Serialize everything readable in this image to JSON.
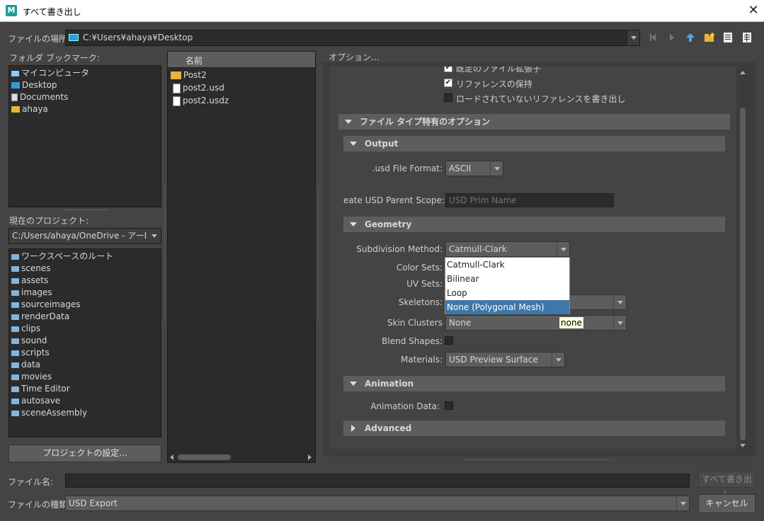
{
  "window": {
    "title": "すべて書き出し",
    "logo": "M",
    "close_icon": "✕"
  },
  "location": {
    "label": "ファイルの場所:",
    "path": "C:¥Users¥ahaya¥Desktop"
  },
  "bookmarks": {
    "label": "フォルダ ブックマーク:",
    "items": [
      "マイコンピュータ",
      "Desktop",
      "Documents",
      "ahaya"
    ]
  },
  "project": {
    "label": "現在のプロジェクト:",
    "path": "C:/Users/ahaya/OneDrive - アーI",
    "folders": [
      "ワークスペースのルート",
      "scenes",
      "assets",
      "images",
      "sourceimages",
      "renderData",
      "clips",
      "sound",
      "scripts",
      "data",
      "movies",
      "Time Editor",
      "autosave",
      "sceneAssembly"
    ],
    "settings_button": "プロジェクトの設定..."
  },
  "files": {
    "column_header": "名前",
    "items": [
      {
        "name": "Post2",
        "type": "folder"
      },
      {
        "name": "post2.usd",
        "type": "file"
      },
      {
        "name": "post2.usdz",
        "type": "file"
      }
    ]
  },
  "options": {
    "label": "オプション...",
    "partial_check_label": "既定のファイル拡張子",
    "keep_references": "リファレンスの保持",
    "export_unloaded_refs": "ロードされていないリファレンスを書き出し",
    "file_type_section": "ファイル タイプ特有のオプション",
    "output_section": "Output",
    "usd_format_label": ".usd File Format:",
    "usd_format_value": "ASCII",
    "parent_scope_label": "eate USD Parent Scope:",
    "parent_scope_placeholder": "USD Prim Name",
    "geometry_section": "Geometry",
    "subdiv_label": "Subdivision Method:",
    "subdiv_value": "Catmull-Clark",
    "subdiv_options": [
      "Catmull-Clark",
      "Bilinear",
      "Loop",
      "None (Polygonal Mesh)"
    ],
    "color_sets_label": "Color Sets:",
    "uv_sets_label": "UV Sets:",
    "skeletons_label": "Skeletons:",
    "skin_clusters_label": "Skin Clusters",
    "skin_clusters_value": "None",
    "tooltip": "none",
    "blend_shapes_label": "Blend Shapes:",
    "materials_label": "Materials:",
    "materials_value": "USD Preview Surface",
    "animation_section": "Animation",
    "animation_data_label": "Animation Data:",
    "advanced_section": "Advanced"
  },
  "footer": {
    "filename_label": "ファイル名:",
    "filename_value": "",
    "export_all_button": "すべて書き出し",
    "filetype_label": "ファイルの種類:",
    "filetype_value": "USD Export",
    "cancel_button": "キャンセル"
  },
  "colors": {
    "accent": "#3f77a8",
    "background": "#444444",
    "panel": "#2b2b2b",
    "section": "#5d5d5d",
    "folder": "#e8b33a"
  }
}
